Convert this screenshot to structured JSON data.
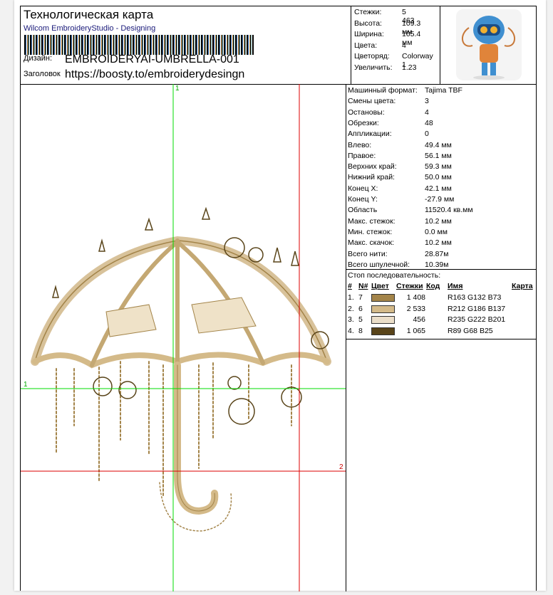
{
  "header": {
    "title": "Технологическая карта",
    "subtitle": "Wilcom EmbroideryStudio - Designing",
    "design_label": "Дизайн:",
    "design_value": "EMBROIDERYAI-UMBRELLA-001",
    "heading_label": "Заголовок",
    "heading_value": "https://boosty.to/embroiderydesingn"
  },
  "summary": [
    {
      "label": "Стежки:",
      "value": "5 463"
    },
    {
      "label": "Высота:",
      "value": "109.3 мм"
    },
    {
      "label": "Ширина:",
      "value": "105.4 мм"
    },
    {
      "label": "Цвета:",
      "value": "4"
    },
    {
      "label": "Цветоряд:",
      "value": "Colorway 1"
    },
    {
      "label": "Увеличить:",
      "value": "1.23"
    }
  ],
  "canvas": {
    "marker_v1": "1",
    "marker_h1": "1",
    "marker_2": "2"
  },
  "details": [
    {
      "label": "Машинный формат:",
      "value": "Tajima TBF"
    },
    {
      "label": "Смены цвета:",
      "value": "3"
    },
    {
      "label": "Остановы:",
      "value": "4"
    },
    {
      "label": "Обрезки:",
      "value": "48"
    },
    {
      "label": "Аппликации:",
      "value": "0"
    },
    {
      "label": "Влево:",
      "value": "49.4 мм"
    },
    {
      "label": "Правое:",
      "value": "56.1 мм"
    },
    {
      "label": "Верхних край:",
      "value": "59.3 мм"
    },
    {
      "label": "Нижний край:",
      "value": "50.0 мм"
    },
    {
      "label": "Конец X:",
      "value": "42.1 мм"
    },
    {
      "label": "Конец Y:",
      "value": "-27.9 мм"
    },
    {
      "label": "Область",
      "value": "11520.4 кв.мм"
    },
    {
      "label": "Макс. стежок:",
      "value": "10.2 мм"
    },
    {
      "label": "Мин. стежок:",
      "value": "0.0 мм"
    },
    {
      "label": "Макс. скачок:",
      "value": "10.2 мм"
    },
    {
      "label": "Всего нити:",
      "value": "28.87м"
    },
    {
      "label": "Всего шпулечной:",
      "value": "10.39м"
    }
  ],
  "sequence": {
    "title": "Стоп последовательность:",
    "columns": {
      "num": "#",
      "n": "N#",
      "color": "Цвет",
      "stitches": "Стежки",
      "code": "Код",
      "name": "Имя",
      "chart": "Карта"
    },
    "rows": [
      {
        "num": "1.",
        "n": "7",
        "color": "#a38449",
        "stitches": "1 408",
        "name": "R163 G132 B73"
      },
      {
        "num": "2.",
        "n": "6",
        "color": "#d4ba89",
        "stitches": "2 533",
        "name": "R212 G186 B137"
      },
      {
        "num": "3.",
        "n": "5",
        "color": "#ebdec9",
        "stitches": "456",
        "name": "R235 G222 B201"
      },
      {
        "num": "4.",
        "n": "8",
        "color": "#594419",
        "stitches": "1 065",
        "name": "R89 G68 B25"
      }
    ]
  }
}
